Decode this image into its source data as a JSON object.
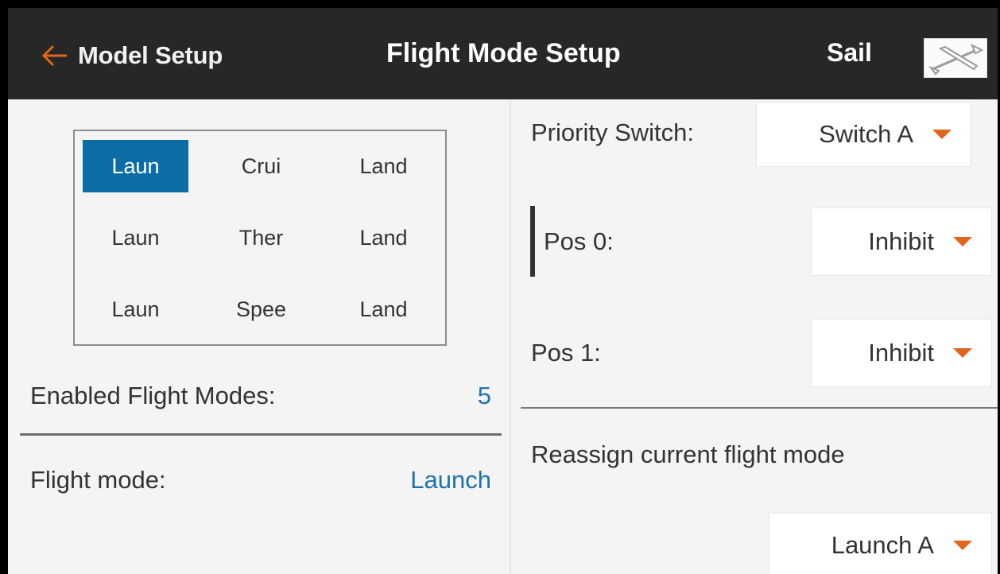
{
  "header": {
    "back_label": "Model Setup",
    "title": "Flight Mode Setup",
    "model_name": "Sail",
    "model_icon": "glider-icon"
  },
  "grid": {
    "rows": [
      [
        "Laun",
        "Crui",
        "Land"
      ],
      [
        "Laun",
        "Ther",
        "Land"
      ],
      [
        "Laun",
        "Spee",
        "Land"
      ]
    ],
    "selected": "Laun (row 1, column 1)"
  },
  "left": {
    "enabled_label": "Enabled Flight Modes:",
    "enabled_value": "5",
    "mode_label": "Flight mode:",
    "mode_value": "Launch"
  },
  "right": {
    "priority_label": "Priority Switch:",
    "priority_value": "Switch A",
    "pos0_label": "Pos 0:",
    "pos0_value": "Inhibit",
    "pos1_label": "Pos 1:",
    "pos1_value": "Inhibit",
    "reassign_label": "Reassign current flight mode",
    "reassign_value": "Launch A"
  },
  "colors": {
    "header_bg": "#272727",
    "accent_orange": "#e0661c",
    "selection_blue": "#0c6da6",
    "value_blue": "#1f73ad"
  }
}
